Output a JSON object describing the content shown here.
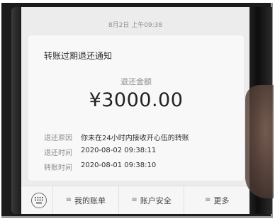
{
  "header": {
    "timestamp": "8月2日 上午09:38"
  },
  "card": {
    "title": "转账过期退还通知",
    "amount_label": "退还金额",
    "amount": "¥3000.00",
    "rows": [
      {
        "key": "退还原因",
        "value": "你未在24小时内接收开心伍的转账"
      },
      {
        "key": "退还时间",
        "value": "2020-08-02 09:38:11"
      },
      {
        "key": "转账时间",
        "value": "2020-08-01 09:38:10"
      }
    ]
  },
  "bottom_menu": {
    "icon": "keyboard-icon",
    "items": [
      {
        "label": "我的账单",
        "icon": "menu-lines-icon"
      },
      {
        "label": "账户安全",
        "icon": "menu-lines-icon"
      },
      {
        "label": "更多",
        "icon": "menu-lines-icon"
      }
    ]
  }
}
